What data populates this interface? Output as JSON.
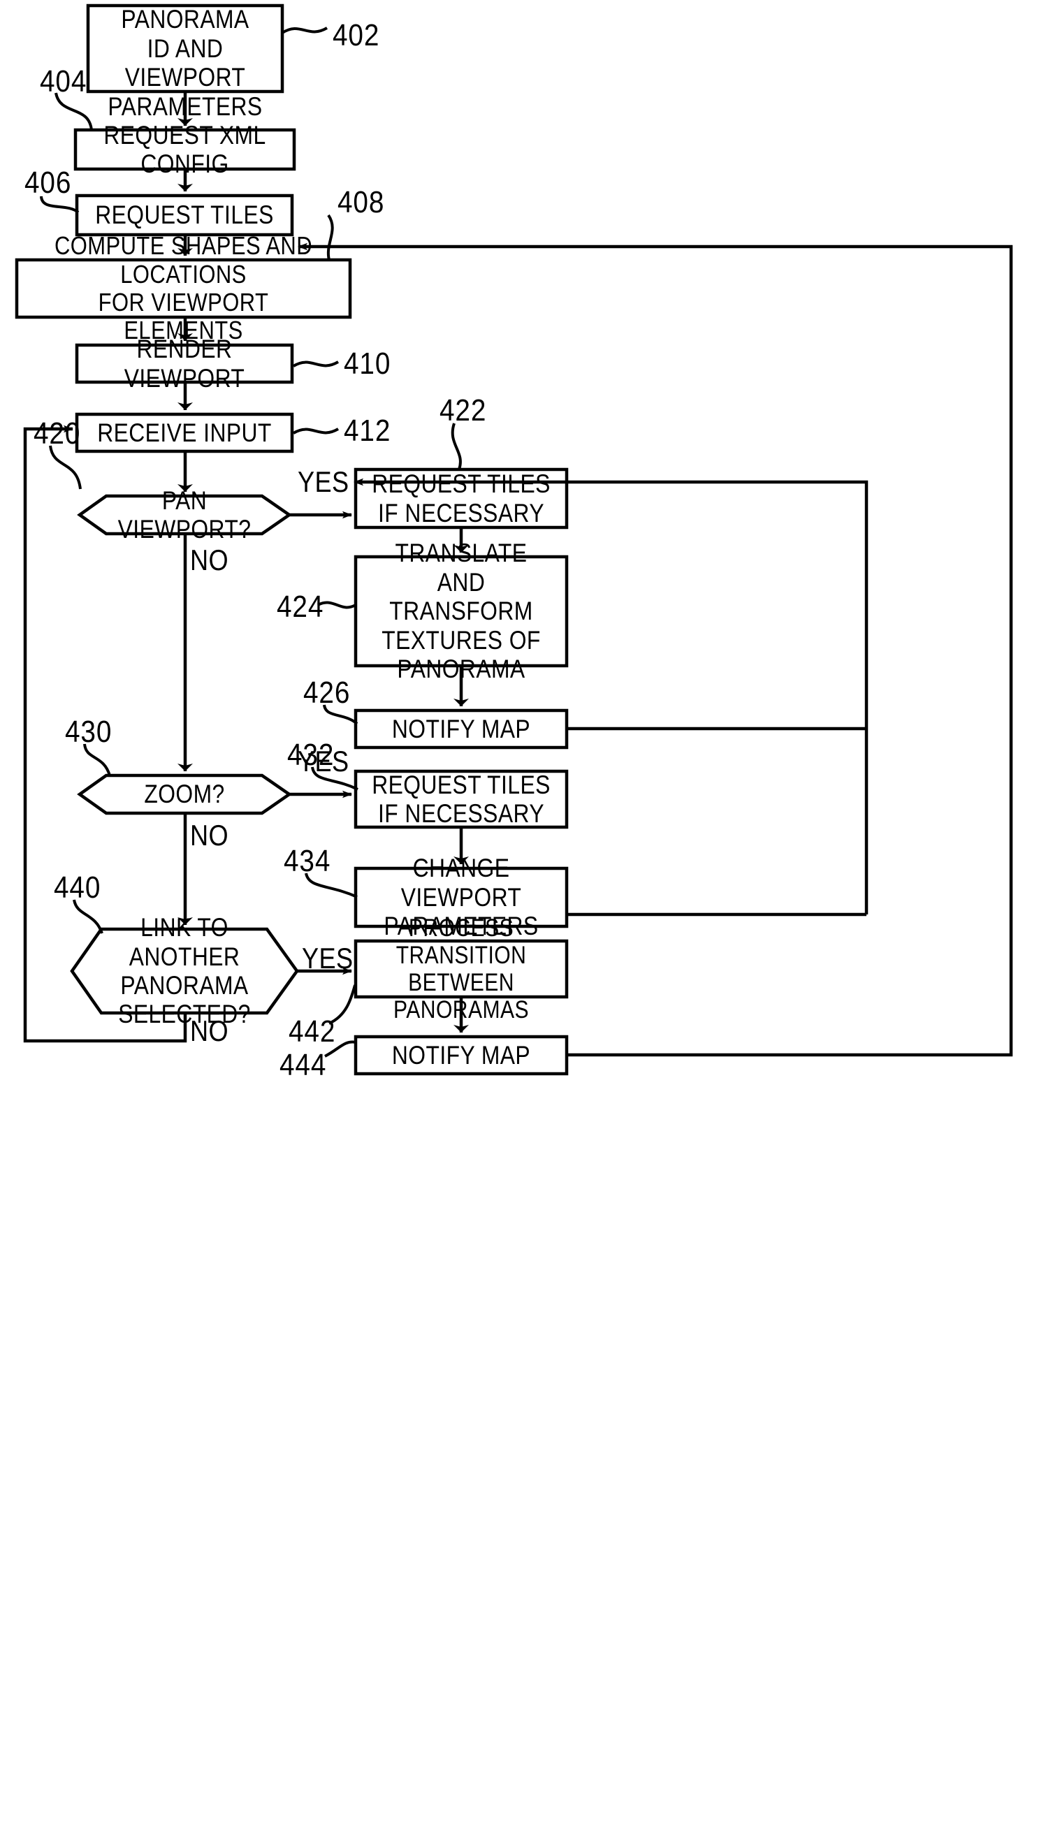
{
  "figure": {
    "title": "Panorama viewer process flowchart",
    "stroke_color": "#000000",
    "background_color": "#ffffff"
  },
  "nodes": [
    {
      "id": "n402",
      "ref": "402",
      "shape": "process",
      "label": "RECEIVE PANORAMA\nID AND VIEWPORT\nPARAMETERS"
    },
    {
      "id": "n404",
      "ref": "404",
      "shape": "process",
      "label": "REQUEST XML CONFIG"
    },
    {
      "id": "n406",
      "ref": "406",
      "shape": "process",
      "label": "REQUEST TILES"
    },
    {
      "id": "n408",
      "ref": "408",
      "shape": "process",
      "label": "COMPUTE SHAPES AND LOCATIONS\nFOR VIEWPORT ELEMENTS"
    },
    {
      "id": "n410",
      "ref": "410",
      "shape": "process",
      "label": "RENDER VIEWPORT"
    },
    {
      "id": "n412",
      "ref": "412",
      "shape": "process",
      "label": "RECEIVE INPUT"
    },
    {
      "id": "n420",
      "ref": "420",
      "shape": "decision",
      "label": "PAN VIEWPORT?"
    },
    {
      "id": "n422",
      "ref": "422",
      "shape": "process",
      "label": "REQUEST TILES\nIF NECESSARY"
    },
    {
      "id": "n424",
      "ref": "424",
      "shape": "process",
      "label": "TRANSLATE AND\nTRANSFORM\nTEXTURES OF\nPANORAMA"
    },
    {
      "id": "n426",
      "ref": "426",
      "shape": "process",
      "label": "NOTIFY MAP"
    },
    {
      "id": "n430",
      "ref": "430",
      "shape": "decision",
      "label": "ZOOM?"
    },
    {
      "id": "n432",
      "ref": "432",
      "shape": "process",
      "label": "REQUEST TILES\nIF NECESSARY"
    },
    {
      "id": "n434",
      "ref": "434",
      "shape": "process",
      "label": "CHANGE VIEWPORT\nPARAMETERS"
    },
    {
      "id": "n440",
      "ref": "440",
      "shape": "decision",
      "label": "LINK TO ANOTHER\nPANORAMA\nSELECTED?"
    },
    {
      "id": "n442",
      "ref": "442",
      "shape": "process",
      "label": "PROCESS TRANSITION\nBETWEEN PANORAMAS"
    },
    {
      "id": "n444",
      "ref": "444",
      "shape": "process",
      "label": "NOTIFY MAP"
    }
  ],
  "branch_labels": {
    "pan_yes": "YES",
    "pan_no": "NO",
    "zoom_yes": "YES",
    "zoom_no": "NO",
    "link_yes": "YES",
    "link_no": "NO"
  },
  "reference_numerals": {
    "r402": "402",
    "r404": "404",
    "r406": "406",
    "r408": "408",
    "r410": "410",
    "r412": "412",
    "r420": "420",
    "r422": "422",
    "r424": "424",
    "r426": "426",
    "r430": "430",
    "r432": "432",
    "r434": "434",
    "r440": "440",
    "r442": "442",
    "r444": "444"
  }
}
